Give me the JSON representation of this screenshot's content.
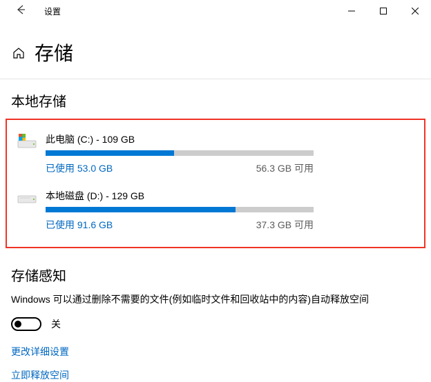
{
  "window": {
    "title": "设置"
  },
  "page": {
    "title": "存储"
  },
  "local_storage": {
    "heading": "本地存储",
    "drives": [
      {
        "name": "此电脑 (C:) - 109 GB",
        "used_label": "已使用 53.0 GB",
        "free_label": "56.3 GB 可用",
        "fill_pct": 48,
        "system": true
      },
      {
        "name": "本地磁盘 (D:) - 129 GB",
        "used_label": "已使用 91.6 GB",
        "free_label": "37.3 GB 可用",
        "fill_pct": 71,
        "system": false
      }
    ]
  },
  "sense": {
    "heading": "存储感知",
    "description": "Windows 可以通过删除不需要的文件(例如临时文件和回收站中的内容)自动释放空间",
    "toggle_state": "关",
    "link_detail": "更改详细设置",
    "link_freenow": "立即释放空间"
  }
}
